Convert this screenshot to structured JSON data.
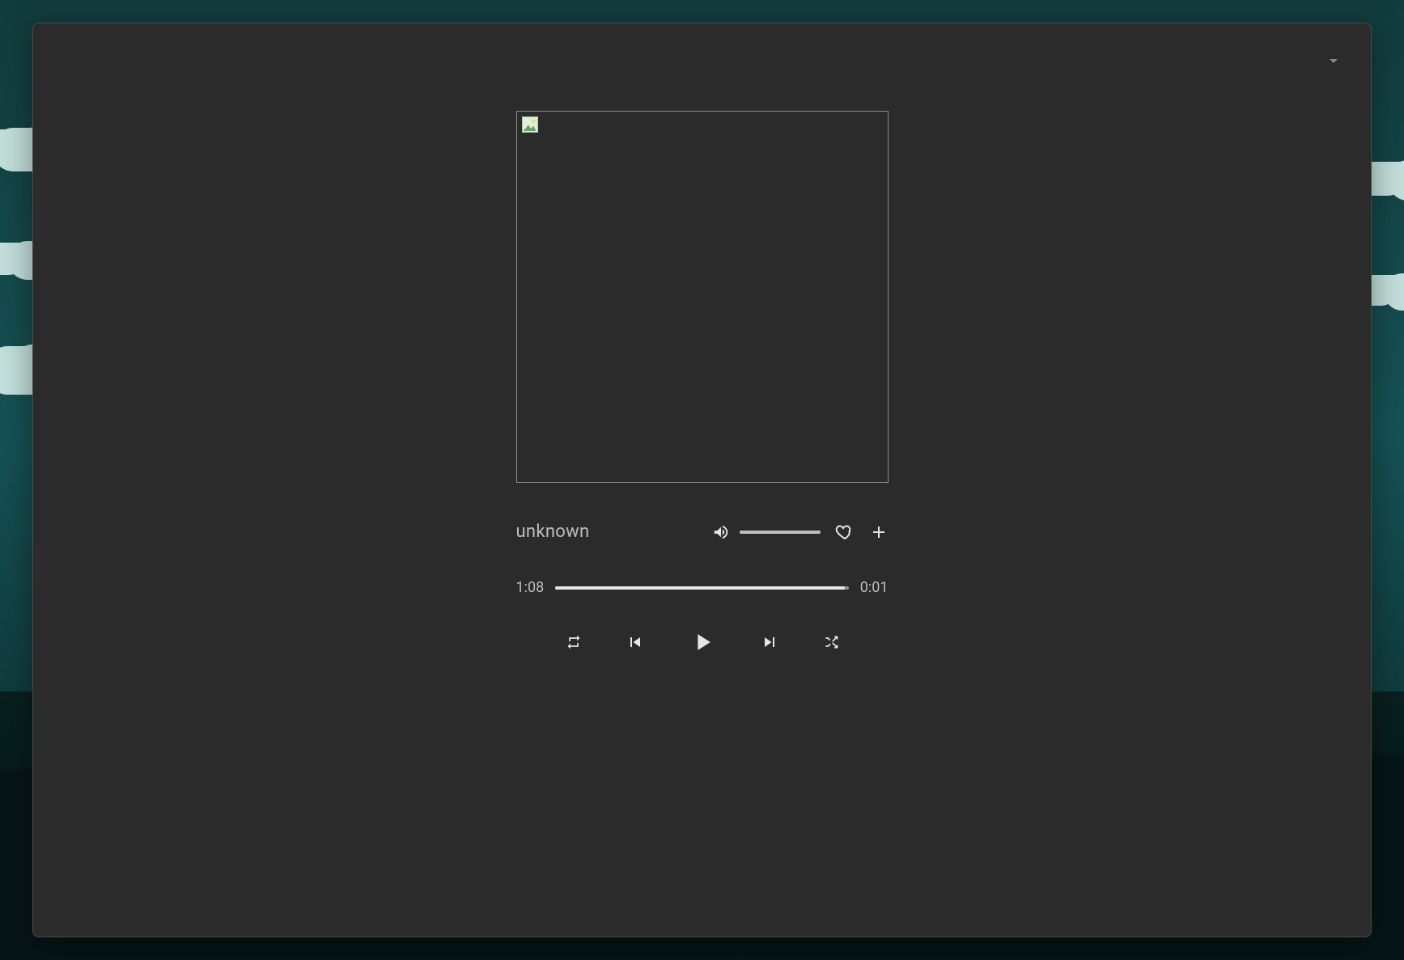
{
  "colors": {
    "panel": "#2b2b2b",
    "panel_border": "#4a4a4a",
    "text_primary": "#e6e6e6",
    "text_muted": "#bdbdbd",
    "text_dim": "#6a6a6a"
  },
  "player": {
    "track_title": "unknown",
    "artwork_loaded": false,
    "volume": {
      "level": 1.0,
      "muted": false
    },
    "favorite": false,
    "time_elapsed": "1:08",
    "time_remaining": "0:01",
    "progress": 0.986,
    "repeat": "off",
    "shuffle": false,
    "playing": false,
    "icons": {
      "collapse": "chevron-down",
      "volume": "volume-high",
      "favorite": "heart-outline",
      "add": "plus",
      "repeat": "repeat",
      "prev": "skip-previous",
      "play": "play",
      "next": "skip-next",
      "shuffle": "shuffle"
    }
  }
}
